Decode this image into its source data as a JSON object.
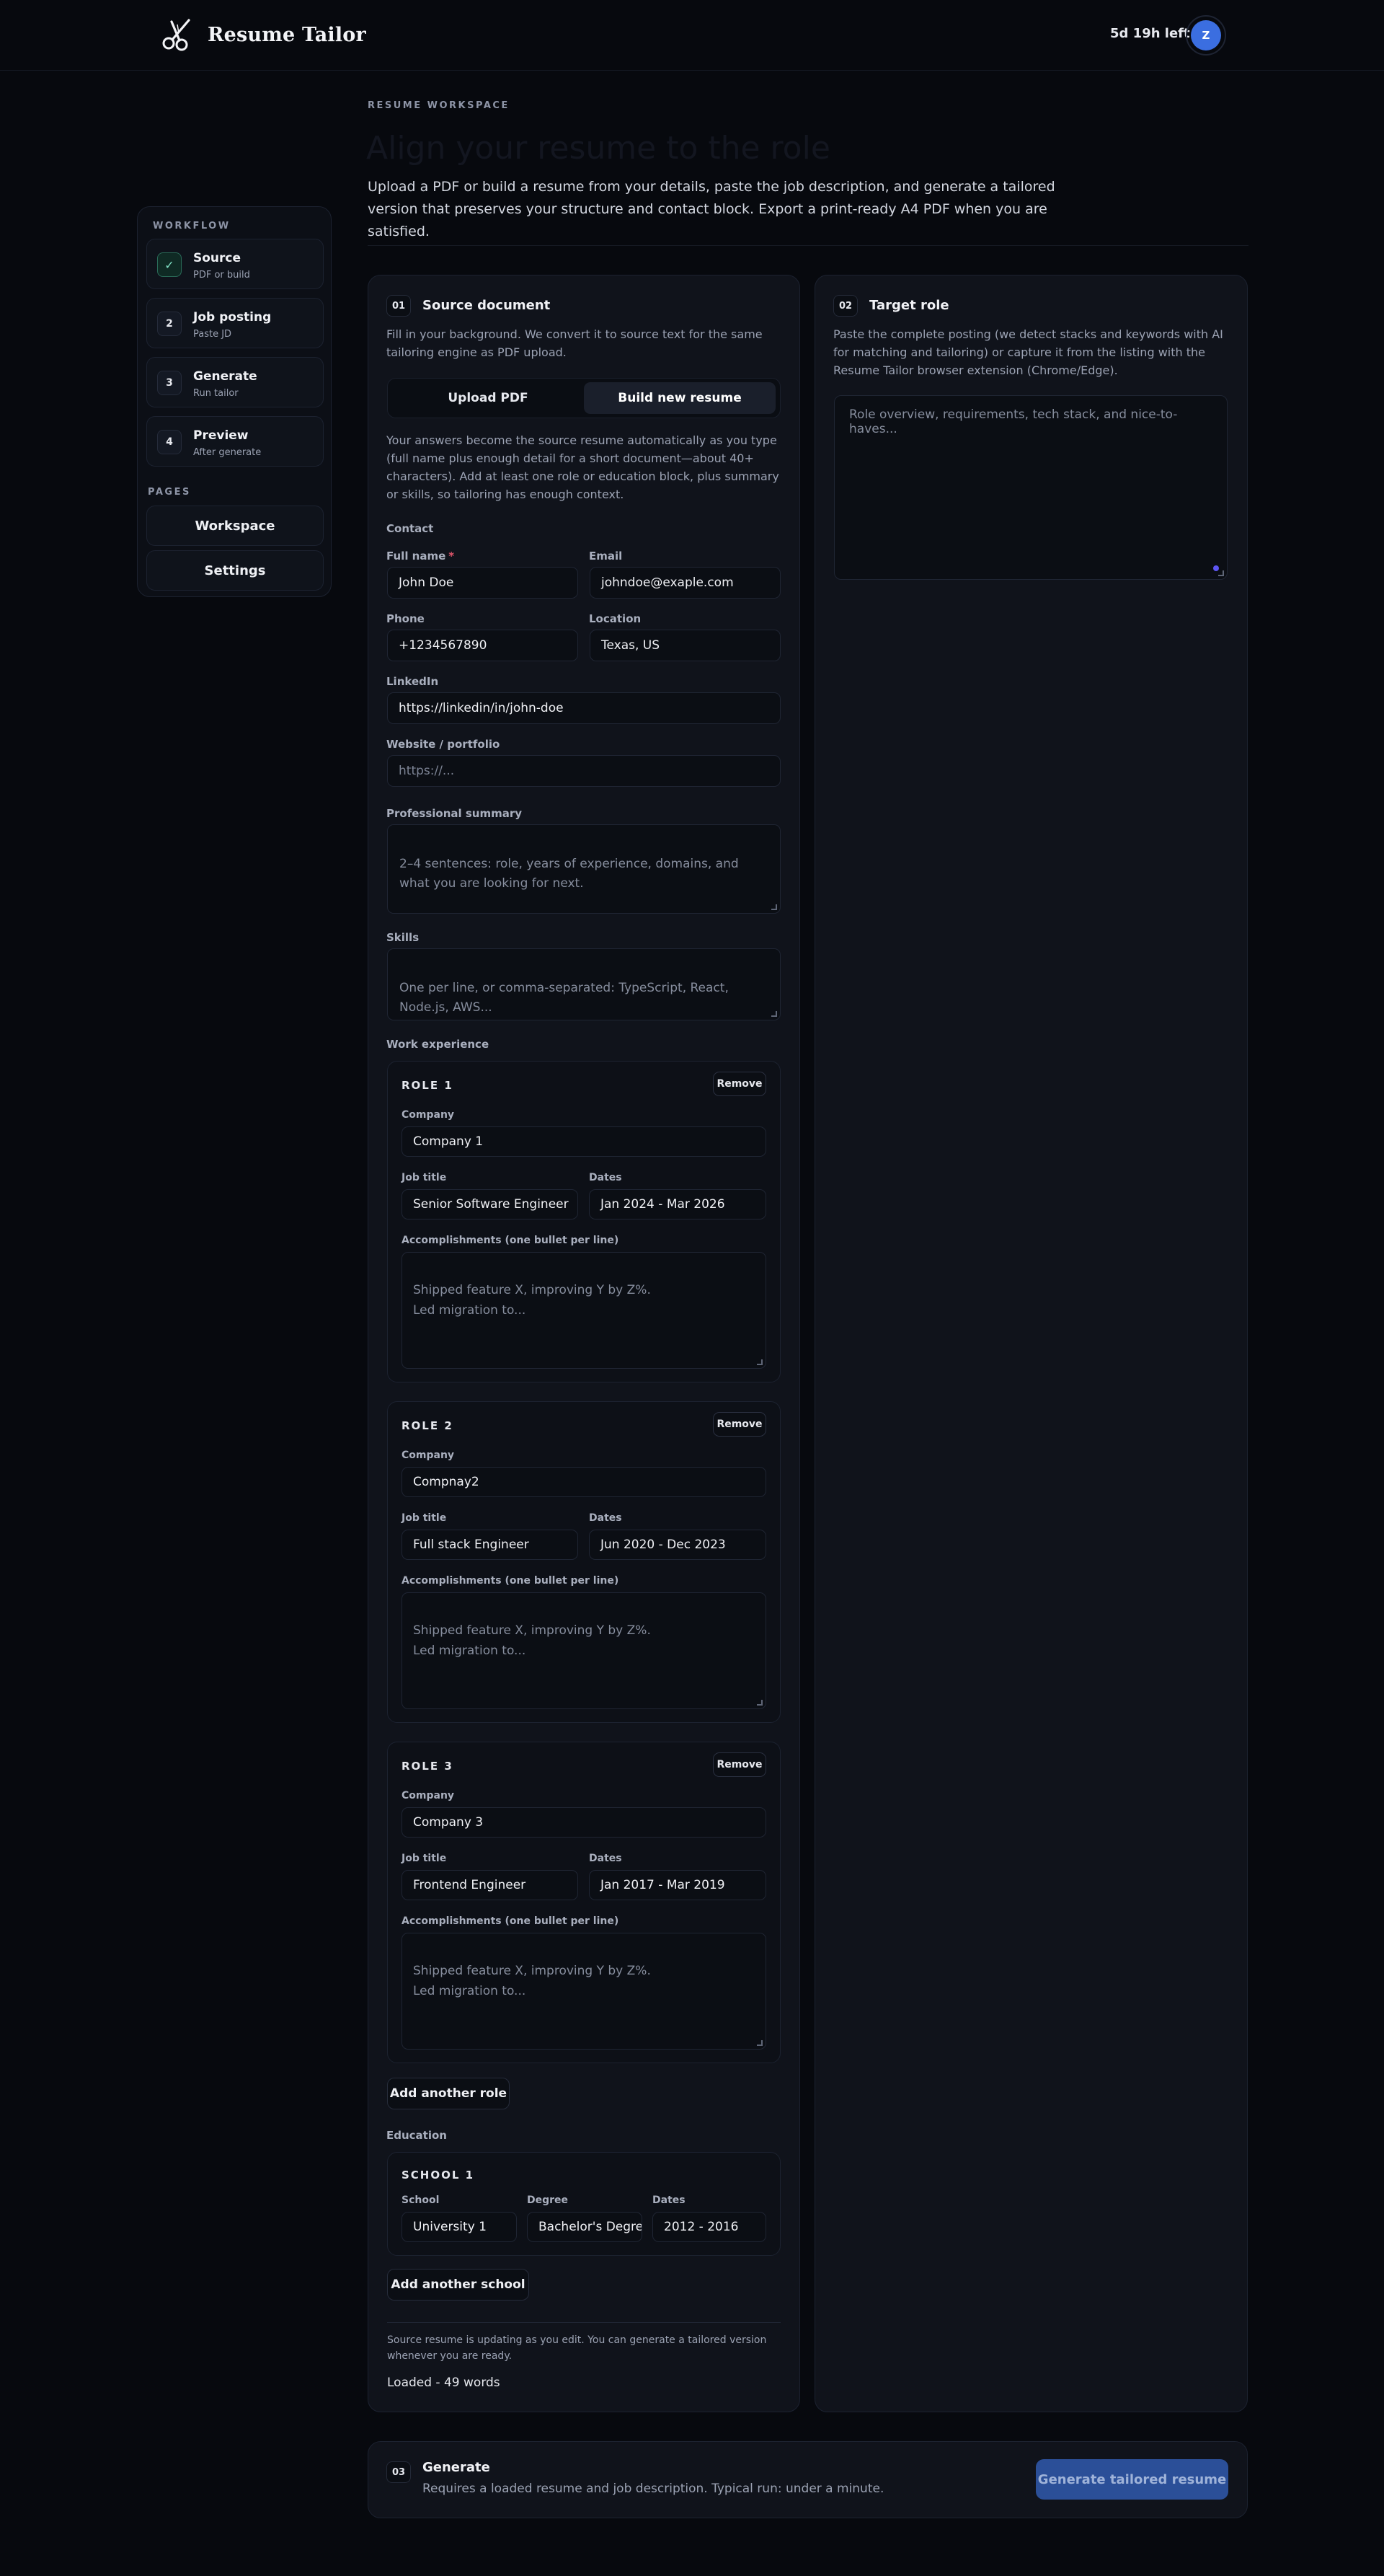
{
  "header": {
    "brand": "Resume Tailor",
    "trial_remaining": "5d 19h left",
    "avatar_initial": "Z"
  },
  "sidebar": {
    "workflow_heading": "WORKFLOW",
    "steps": [
      {
        "marker": "✓",
        "title": "Source",
        "subtitle": "PDF or build",
        "state": "done"
      },
      {
        "marker": "2",
        "title": "Job posting",
        "subtitle": "Paste JD"
      },
      {
        "marker": "3",
        "title": "Generate",
        "subtitle": "Run tailor"
      },
      {
        "marker": "4",
        "title": "Preview",
        "subtitle": "After generate"
      }
    ],
    "pages_heading": "PAGES",
    "pages": [
      "Workspace",
      "Settings"
    ]
  },
  "hero": {
    "eyebrow": "RESUME WORKSPACE",
    "title": "Align your resume to the role",
    "description": "Upload a PDF or build a resume from your details, paste the job description, and generate a tailored version that preserves your structure and contact block. Export a print-ready A4 PDF when you are satisfied."
  },
  "source": {
    "number": "01",
    "title": "Source document",
    "description": "Fill in your background. We convert it to source text for the same tailoring engine as PDF upload.",
    "modes": [
      "Upload PDF",
      "Build new resume"
    ],
    "active_mode": "Build new resume",
    "intro": "Your answers become the source resume automatically as you type (full name plus enough detail for a short document—about 40+ characters). Add at least one role or education block, plus summary or skills, so tailoring has enough context.",
    "contact_heading": "Contact",
    "full_name": {
      "label": "Full name",
      "required_mark": "*",
      "value": "John Doe"
    },
    "email": {
      "label": "Email",
      "value": "johndoe@exaple.com"
    },
    "phone": {
      "label": "Phone",
      "value": "+1234567890"
    },
    "location": {
      "label": "Location",
      "value": "Texas, US"
    },
    "linkedin": {
      "label": "LinkedIn",
      "value": "https://linkedin/in/john-doe"
    },
    "website": {
      "label": "Website / portfolio",
      "placeholder": "https://..."
    },
    "summary": {
      "label": "Professional summary",
      "placeholder": "2–4 sentences: role, years of experience, domains, and what you are looking for next."
    },
    "skills": {
      "label": "Skills",
      "placeholder": "One per line, or comma-separated: TypeScript, React, Node.js, AWS..."
    },
    "work_heading": "Work experience",
    "role_labels": {
      "company": "Company",
      "job_title": "Job title",
      "dates": "Dates",
      "accomplishments": "Accomplishments (one bullet per line)",
      "accomplishments_placeholder": "Shipped feature X, improving Y by Z%.\nLed migration to...",
      "remove": "Remove"
    },
    "roles": [
      {
        "heading": "ROLE 1",
        "company": "Company 1",
        "job_title": "Senior Software Engineer",
        "dates": "Jan 2024 - Mar 2026"
      },
      {
        "heading": "ROLE 2",
        "company": "Compnay2",
        "job_title": "Full stack Engineer",
        "dates": "Jun 2020 - Dec 2023"
      },
      {
        "heading": "ROLE 3",
        "company": "Company 3",
        "job_title": "Frontend Engineer",
        "dates": "Jan 2017  - Mar 2019"
      }
    ],
    "add_role": "Add another role",
    "education_heading": "Education",
    "school": {
      "heading": "SCHOOL 1",
      "school_label": "School",
      "degree_label": "Degree",
      "dates_label": "Dates",
      "school": "University 1",
      "degree": "Bachelor's Degree",
      "dates": "2012 - 2016"
    },
    "add_school": "Add another school",
    "footer_note": "Source resume is updating as you edit. You can generate a tailored version whenever you are ready.",
    "loaded_status": "Loaded - 49 words"
  },
  "target": {
    "number": "02",
    "title": "Target role",
    "description": "Paste the complete posting (we detect stacks and keywords with AI for matching and tailoring) or capture it from the listing with the Resume Tailor browser extension (Chrome/Edge).",
    "placeholder": "Role overview, requirements, tech stack, and nice-to-haves..."
  },
  "generate": {
    "number": "03",
    "title": "Generate",
    "description": "Requires a loaded resume and job description. Typical run: under a minute.",
    "button": "Generate tailored resume"
  },
  "colors": {
    "background": "#07090e",
    "panel": "#10131b",
    "accent": "#2b4f98",
    "avatar": "#3b6ee0",
    "done_step": "#7fe0c4"
  }
}
